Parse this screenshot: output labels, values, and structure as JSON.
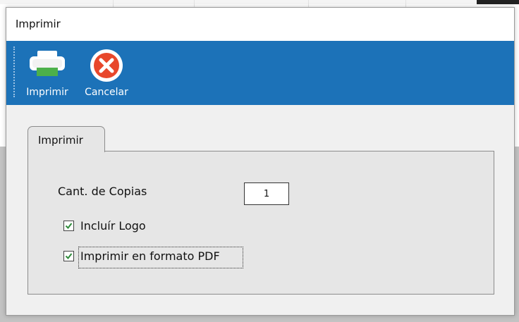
{
  "dialog": {
    "title": "Imprimir"
  },
  "toolbar": {
    "print_label": "Imprimir",
    "cancel_label": "Cancelar"
  },
  "tab": {
    "label": "Imprimir"
  },
  "form": {
    "copies_label": "Cant. de Copias",
    "copies_value": "1",
    "include_logo_label": "Incluír Logo",
    "include_logo_checked": true,
    "pdf_label": "Imprimir en formato PDF",
    "pdf_checked": true
  },
  "colors": {
    "ribbon": "#1c72b8",
    "cancel_icon": "#e8472b",
    "check_mark": "#2e8b3a"
  }
}
